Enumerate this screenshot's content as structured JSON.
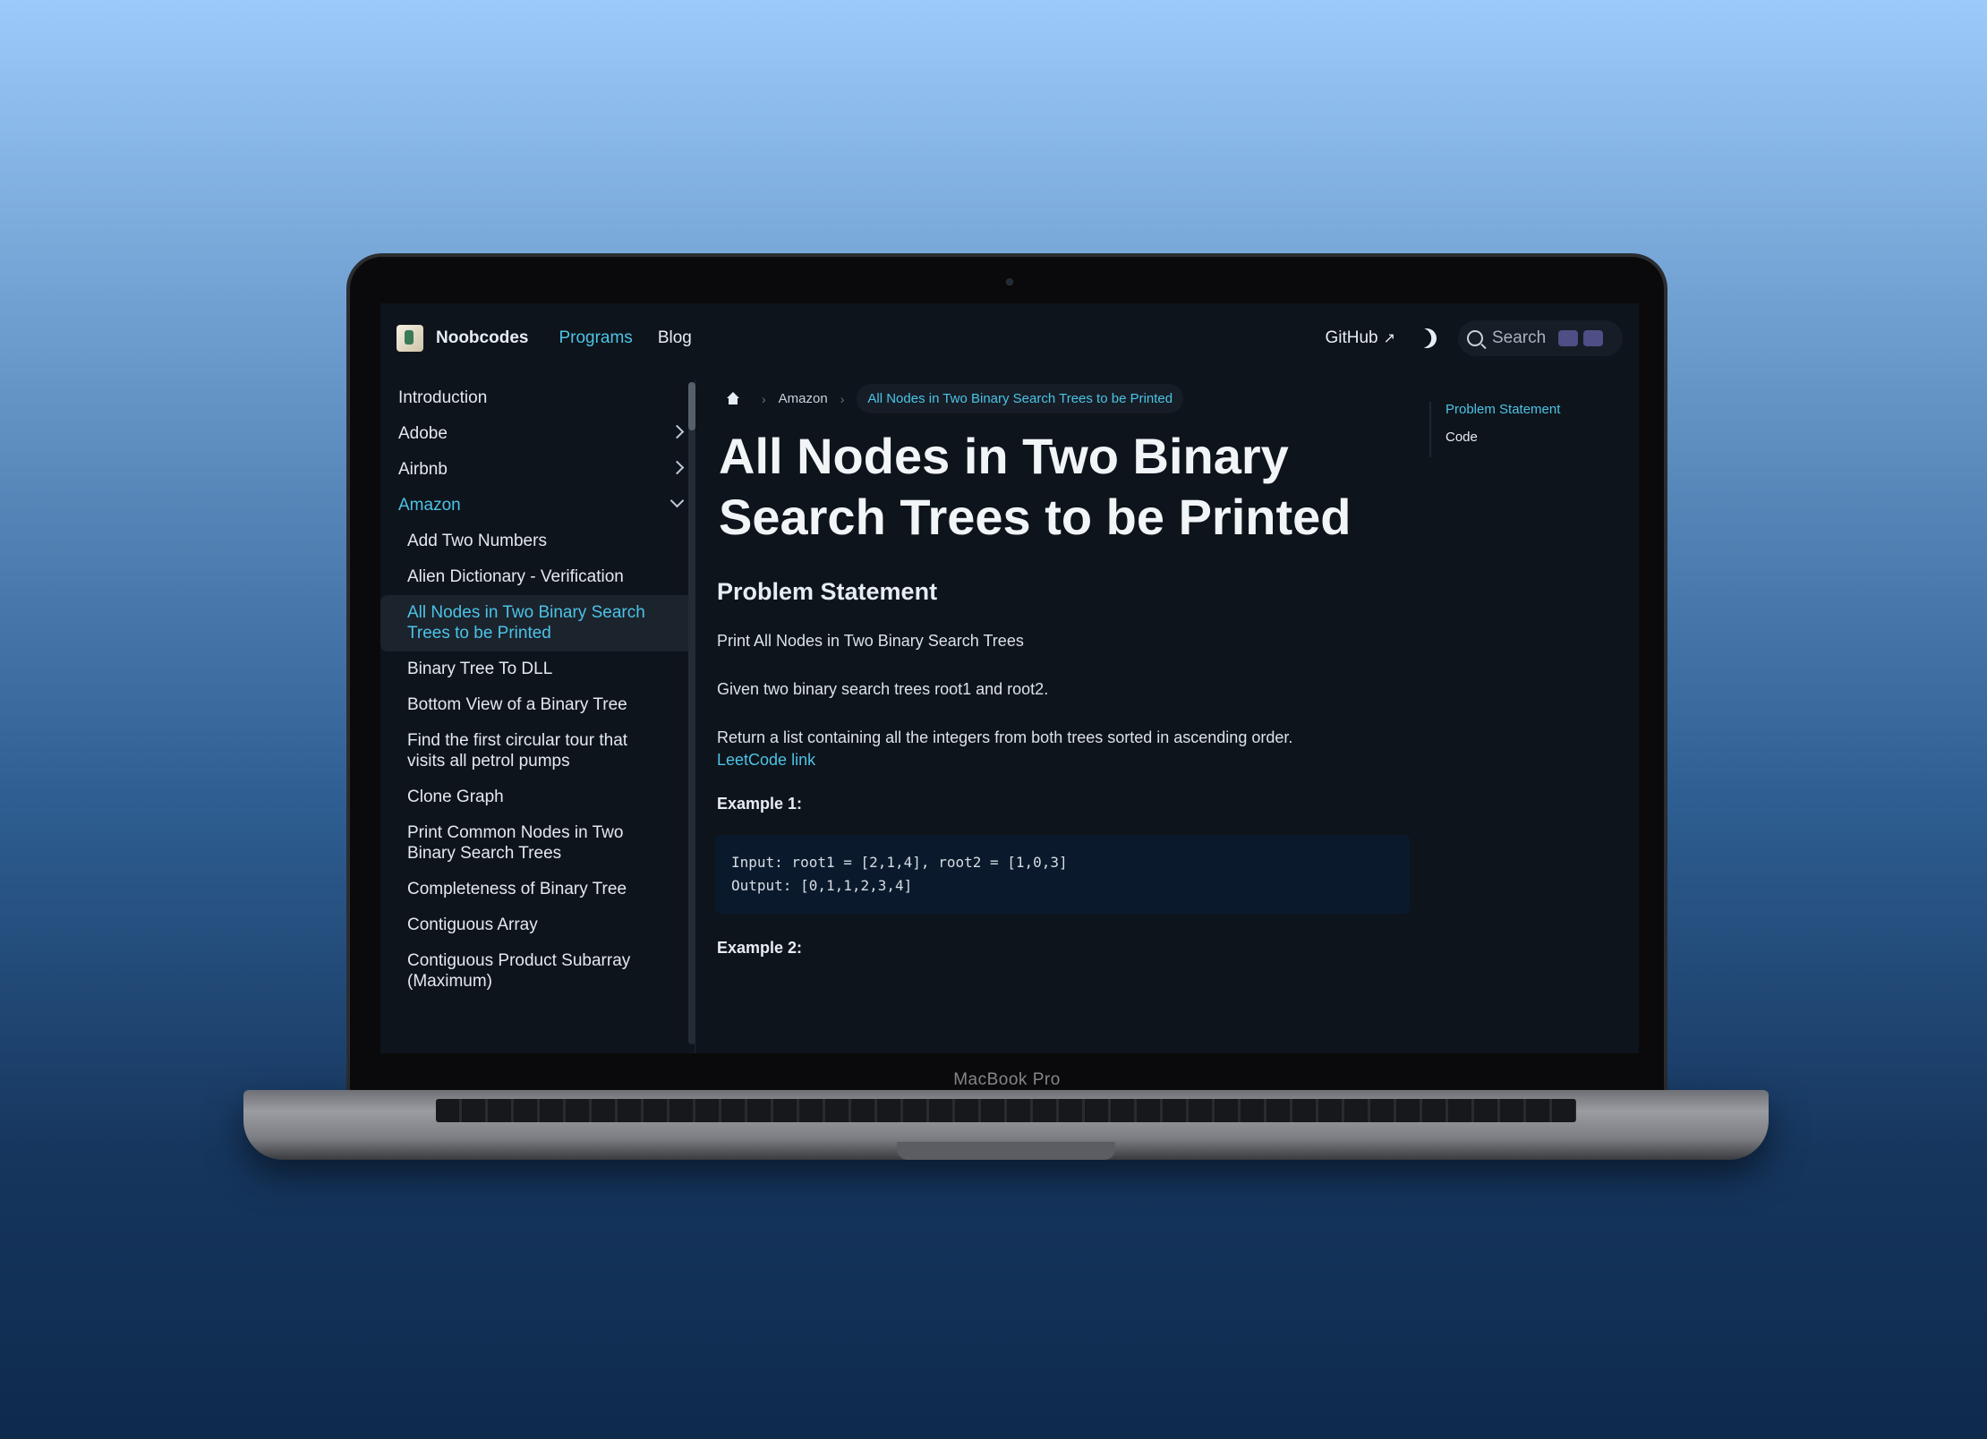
{
  "device": {
    "label": "MacBook Pro"
  },
  "navbar": {
    "brand": "Noobcodes",
    "links": [
      {
        "label": "Programs",
        "active": true
      },
      {
        "label": "Blog",
        "active": false
      }
    ],
    "github": "GitHub",
    "search_placeholder": "Search"
  },
  "sidebar": {
    "items": [
      {
        "label": "Introduction",
        "chevron": "none",
        "level": 0
      },
      {
        "label": "Adobe",
        "chevron": "right",
        "level": 0
      },
      {
        "label": "Airbnb",
        "chevron": "right",
        "level": 0
      },
      {
        "label": "Amazon",
        "chevron": "down",
        "level": 0,
        "open": true
      },
      {
        "label": "Add Two Numbers",
        "level": 1
      },
      {
        "label": "Alien Dictionary - Verification",
        "level": 1
      },
      {
        "label": "All Nodes in Two Binary Search Trees to be Printed",
        "level": 1,
        "current": true
      },
      {
        "label": "Binary Tree To DLL",
        "level": 1
      },
      {
        "label": "Bottom View of a Binary Tree",
        "level": 1
      },
      {
        "label": "Find the first circular tour that visits all petrol pumps",
        "level": 1
      },
      {
        "label": "Clone Graph",
        "level": 1
      },
      {
        "label": "Print Common Nodes in Two Binary Search Trees",
        "level": 1
      },
      {
        "label": "Completeness of Binary Tree",
        "level": 1
      },
      {
        "label": "Contiguous Array",
        "level": 1
      },
      {
        "label": "Contiguous Product Subarray (Maximum)",
        "level": 1
      }
    ]
  },
  "breadcrumb": {
    "parent": "Amazon",
    "current": "All Nodes in Two Binary Search Trees to be Printed"
  },
  "article": {
    "title": "All Nodes in Two Binary Search Trees to be Printed",
    "section_heading": "Problem Statement",
    "para1": "Print All Nodes in Two Binary Search Trees",
    "para2": "Given two binary search trees root1 and root2.",
    "para3": "Return a list containing all the integers from both trees sorted in ascending order.",
    "link": "LeetCode link",
    "example1_heading": "Example 1:",
    "example1_code": "Input: root1 = [2,1,4], root2 = [1,0,3]\nOutput: [0,1,1,2,3,4]",
    "example2_heading": "Example 2:"
  },
  "toc": {
    "items": [
      {
        "label": "Problem Statement",
        "active": true
      },
      {
        "label": "Code",
        "active": false
      }
    ]
  },
  "colors": {
    "accent": "#4cc3e6",
    "background": "#0e141b"
  }
}
